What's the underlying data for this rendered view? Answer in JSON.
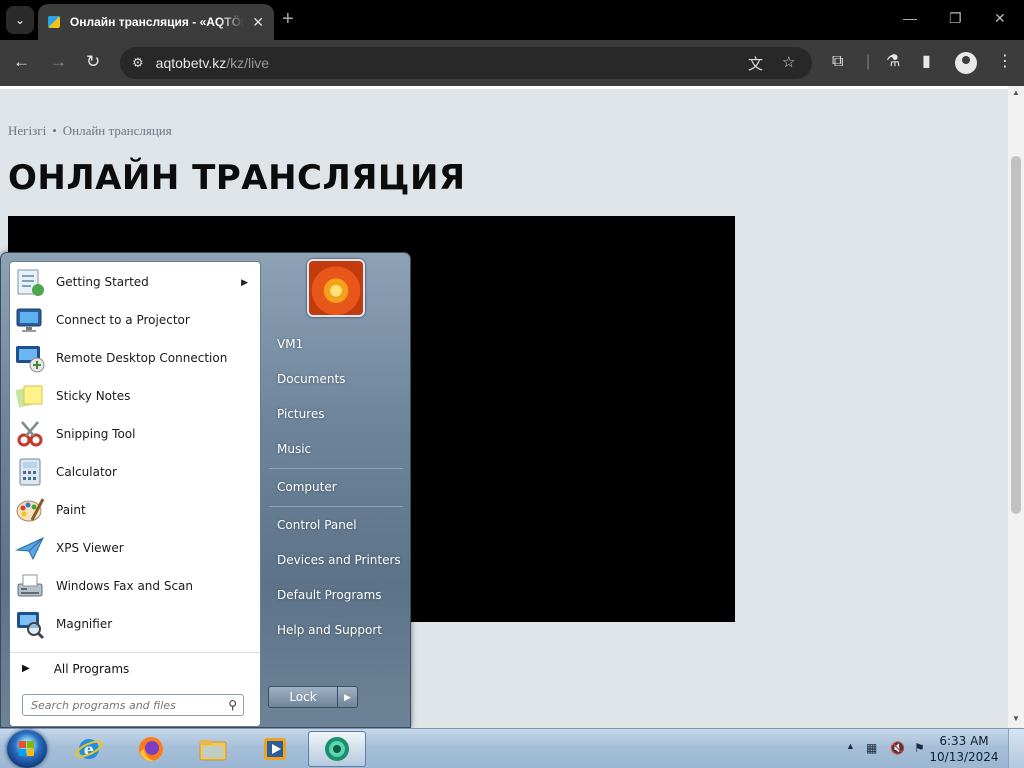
{
  "browser": {
    "tab_title": "Онлайн трансляция - «AQTÖBE",
    "url_domain": "aqtobetv.kz",
    "url_path": "/kz/live",
    "icons": [
      "tab-search-icon",
      "favicon-icon",
      "close-icon",
      "new-tab-icon",
      "minimize-icon",
      "restore-icon",
      "window-close-icon",
      "back-icon",
      "forward-icon",
      "reload-icon",
      "site-info-icon",
      "translate-icon",
      "bookmark-star-icon",
      "extensions-icon",
      "labs-icon",
      "side-panel-icon",
      "profile-icon",
      "menu-icon"
    ]
  },
  "page": {
    "breadcrumb": {
      "home": "Негізгі",
      "current": "Онлайн трансляция"
    },
    "title": "ОНЛАЙН ТРАНСЛЯЦИЯ"
  },
  "start_menu": {
    "programs": [
      {
        "label": "Getting Started",
        "icon": "getting-started-icon",
        "has_submenu": true
      },
      {
        "label": "Connect to a Projector",
        "icon": "projector-icon",
        "has_submenu": false
      },
      {
        "label": "Remote Desktop Connection",
        "icon": "remote-desktop-icon",
        "has_submenu": false
      },
      {
        "label": "Sticky Notes",
        "icon": "sticky-notes-icon",
        "has_submenu": false
      },
      {
        "label": "Snipping Tool",
        "icon": "snipping-tool-icon",
        "has_submenu": false
      },
      {
        "label": "Calculator",
        "icon": "calculator-icon",
        "has_submenu": false
      },
      {
        "label": "Paint",
        "icon": "paint-icon",
        "has_submenu": false
      },
      {
        "label": "XPS Viewer",
        "icon": "xps-viewer-icon",
        "has_submenu": false
      },
      {
        "label": "Windows Fax and Scan",
        "icon": "fax-scan-icon",
        "has_submenu": false
      },
      {
        "label": "Magnifier",
        "icon": "magnifier-icon",
        "has_submenu": false
      }
    ],
    "all_programs": "All Programs",
    "search_placeholder": "Search programs and files",
    "right_links": [
      "VM1",
      "Documents",
      "Pictures",
      "Music",
      "Computer",
      "Control Panel",
      "Devices and Printers",
      "Default Programs",
      "Help and Support"
    ],
    "lock_label": "Lock"
  },
  "taskbar": {
    "apps": [
      "internet-explorer-icon",
      "firefox-icon",
      "file-explorer-icon",
      "media-player-icon",
      "chrome-active-icon"
    ],
    "clock_time": "6:33 AM",
    "clock_date": "10/13/2024"
  },
  "colors": {
    "page_bg": "#dfe4e8",
    "title_text": "#0c0c0c",
    "start_menu_accent": "#6e859c",
    "taskbar": "#a6bfd8"
  }
}
